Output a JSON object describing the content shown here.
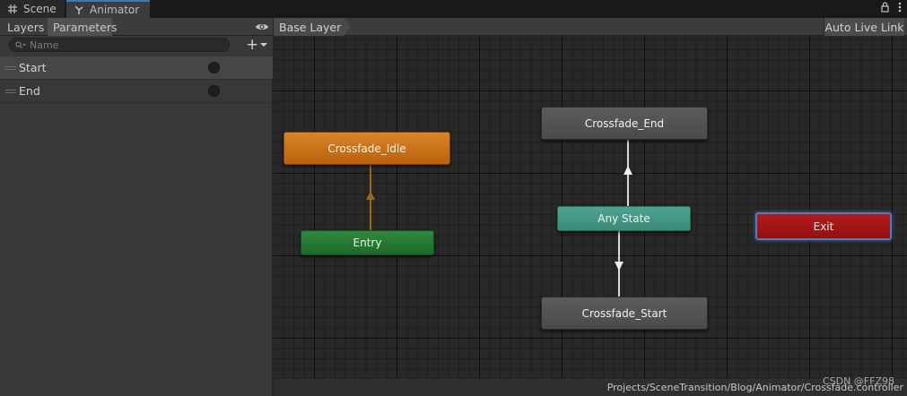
{
  "tabs": {
    "scene": "Scene",
    "animator": "Animator"
  },
  "left_panel": {
    "tabs": {
      "layers": "Layers",
      "parameters": "Parameters"
    },
    "search": {
      "placeholder": "Name"
    },
    "add_button": "+",
    "parameters": [
      {
        "label": "Start",
        "type": "trigger"
      },
      {
        "label": "End",
        "type": "trigger"
      }
    ]
  },
  "graph_header": {
    "breadcrumb": "Base Layer",
    "auto_live_link": "Auto Live Link"
  },
  "states": {
    "crossfade_idle": "Crossfade_Idle",
    "entry": "Entry",
    "crossfade_end": "Crossfade_End",
    "any_state": "Any State",
    "crossfade_start": "Crossfade_Start",
    "exit": "Exit"
  },
  "colors": {
    "default_state": "#d98426",
    "entry": "#2f8a3b",
    "any_state": "#4ea592",
    "exit": "#b51a1a",
    "state": "#5c5c5c",
    "selection": "#4a7fc4"
  },
  "footer": {
    "path": "Projects/SceneTransition/Blog/Animator/Crossfade.controller"
  },
  "watermark": "CSDN @FFZ98"
}
